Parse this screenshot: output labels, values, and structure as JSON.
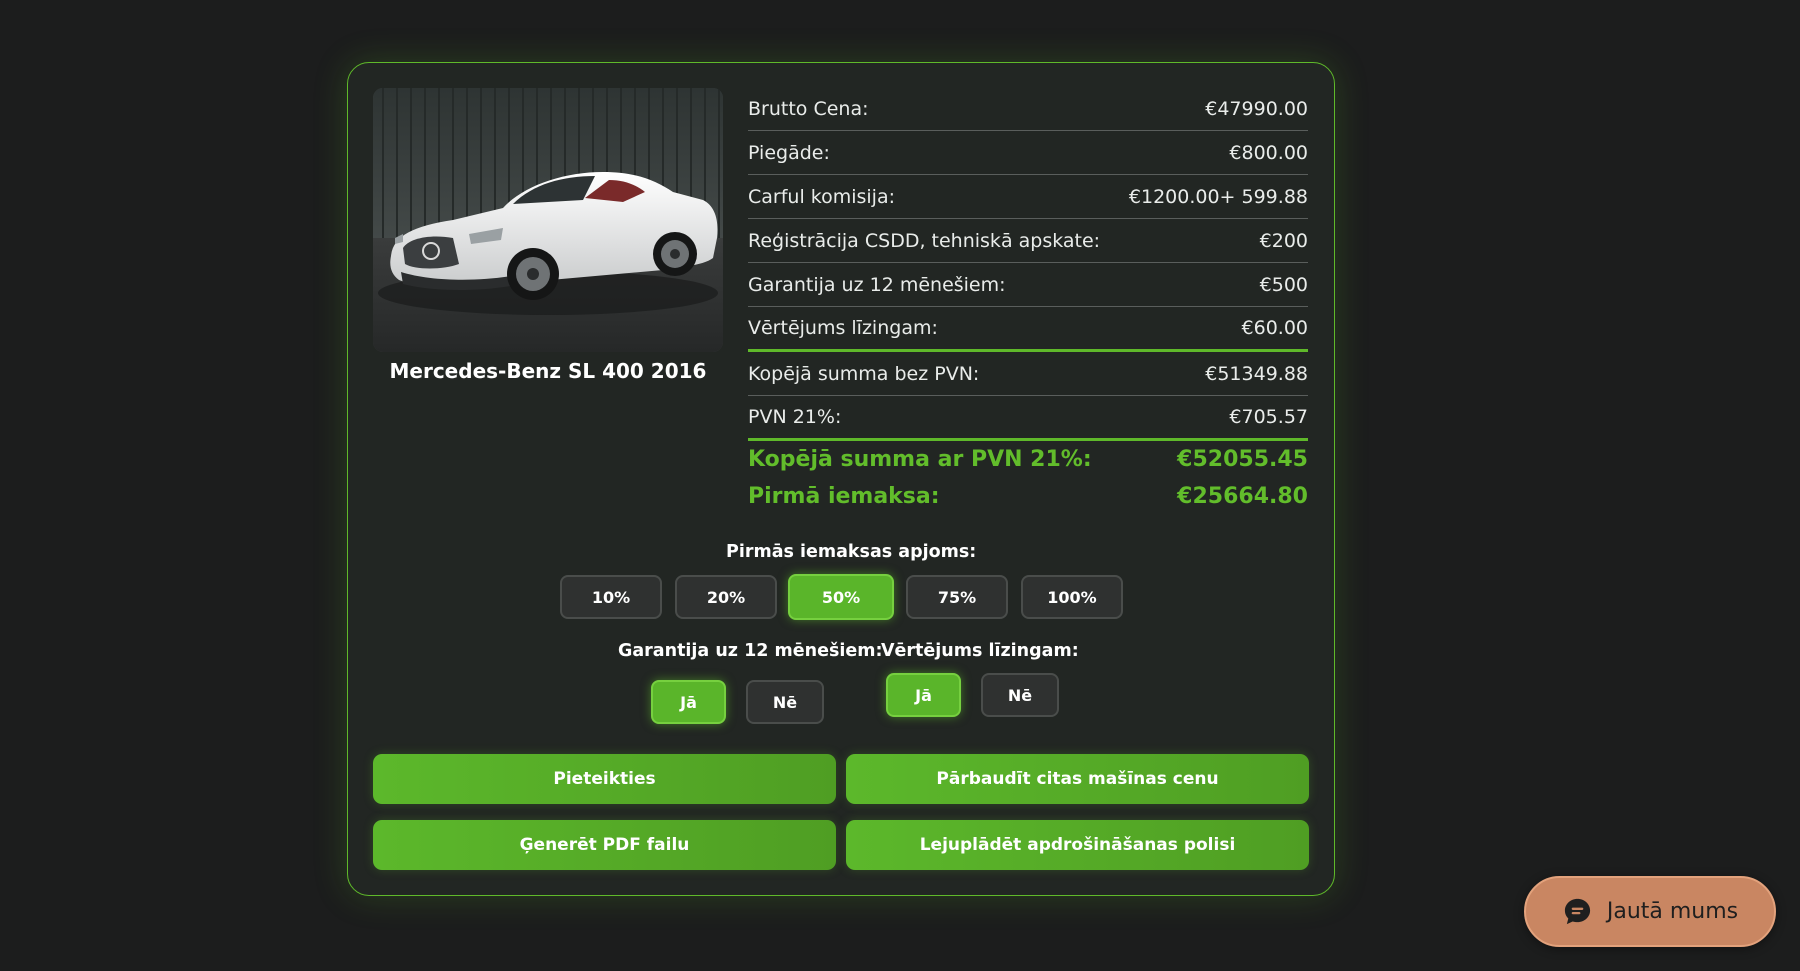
{
  "car": {
    "title": "Mercedes-Benz SL 400 2016"
  },
  "prices": [
    {
      "label": "Brutto Cena:",
      "value": "€47990.00"
    },
    {
      "label": "Piegāde:",
      "value": "€800.00"
    },
    {
      "label": "Carful komisija:",
      "value": "€1200.00+ 599.88"
    },
    {
      "label": "Reģistrācija CSDD, tehniskā apskate:",
      "value": "€200"
    },
    {
      "label": "Garantija uz 12 mēnešiem:",
      "value": "€500"
    },
    {
      "label": "Vērtējums līzingam:",
      "value": "€60.00"
    },
    {
      "label": "Kopējā summa bez PVN:",
      "value": "€51349.88"
    },
    {
      "label": "PVN 21%:",
      "value": "€705.57"
    }
  ],
  "totals": {
    "with_vat_label": "Kopējā summa ar PVN 21%:",
    "with_vat_value": "€52055.45",
    "first_payment_label": "Pirmā iemaksa:",
    "first_payment_value": "€25664.80"
  },
  "down_payment": {
    "title": "Pirmās iemaksas apjoms:",
    "options": [
      "10%",
      "20%",
      "50%",
      "75%",
      "100%"
    ],
    "selected": "50%"
  },
  "warranty": {
    "title": "Garantija uz 12 mēnešiem:",
    "yes": "Jā",
    "no": "Nē",
    "selected": "Jā"
  },
  "valuation": {
    "title": "Vērtējums līzingam:",
    "yes": "Jā",
    "no": "Nē",
    "selected": "Jā"
  },
  "actions": {
    "apply": "Pieteikties",
    "check_other": "Pārbaudīt citas mašīnas cenu",
    "generate_pdf": "Ģenerēt PDF failu",
    "download_policy": "Lejuplādēt apdrošināšanas polisi"
  },
  "chat": {
    "label": "Jautā mums",
    "icon": "chat-bubble-icon"
  },
  "colors": {
    "accent": "#5fb92a",
    "background": "#1c1d1d",
    "card": "#222623",
    "chat": "#c98662"
  }
}
